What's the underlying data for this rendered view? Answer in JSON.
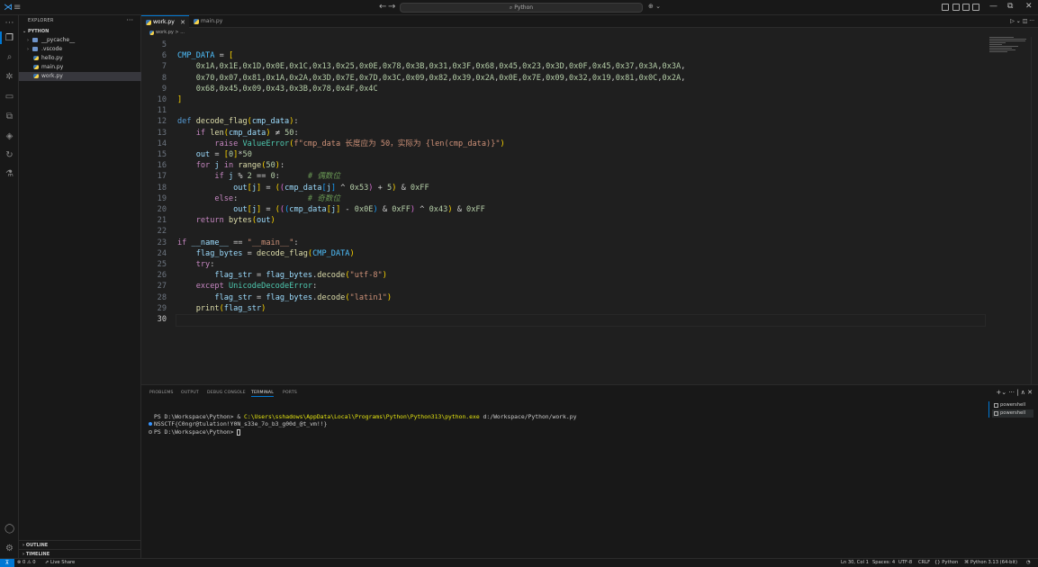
{
  "titlebar": {
    "search_text": "Python",
    "nav_back": "←",
    "nav_forward": "→",
    "copilot_icon": "⊕ ⌄",
    "icons": [
      "vscode-logo-icon",
      "menu-icon",
      "copilot-icon",
      "toggle-layout-icon",
      "minimize-icon",
      "restore-icon",
      "close-icon"
    ],
    "min": "—",
    "restore": "⧉",
    "close": "✕"
  },
  "activity_bar": {
    "items": [
      "explorer-icon",
      "search-icon",
      "source-control-icon",
      "run-debug-icon",
      "remote-explorer-icon",
      "extensions-icon",
      "database-icon",
      "live-share-icon",
      "testing-icon",
      "accounts-icon",
      "settings-icon"
    ]
  },
  "sidebar": {
    "header": "EXPLORER",
    "more": "···",
    "root_folder": "PYTHON",
    "tree": [
      {
        "label": "__pycache__",
        "type": "folder"
      },
      {
        "label": ".vscode",
        "type": "folder"
      },
      {
        "label": "hello.py",
        "type": "file"
      },
      {
        "label": "main.py",
        "type": "file"
      },
      {
        "label": "work.py",
        "type": "file"
      }
    ],
    "outline": "OUTLINE",
    "timeline": "TIMELINE"
  },
  "tabs": [
    {
      "label": "work.py",
      "active": true,
      "close": "✕"
    },
    {
      "label": "main.py",
      "active": false
    }
  ],
  "tab_actions": "▷ ⌄  ◫  ···",
  "breadcrumb": "work.py > ...",
  "editor": {
    "current_line": 30,
    "lines": [
      {
        "n": "5",
        "t": ""
      },
      {
        "n": "6",
        "t": "CMP_DATA = ["
      },
      {
        "n": "7",
        "t": "    0x1A,0x1E,0x1D,0x0E,0x1C,0x13,0x25,0x0E,0x78,0x3B,0x31,0x3F,0x68,0x45,0x23,0x3D,0x0F,0x45,0x37,0x3A,0x3A,"
      },
      {
        "n": "8",
        "t": "    0x70,0x07,0x81,0x1A,0x2A,0x3D,0x7E,0x7D,0x3C,0x09,0x82,0x39,0x2A,0x0E,0x7E,0x09,0x32,0x19,0x81,0x0C,0x2A,"
      },
      {
        "n": "9",
        "t": "    0x68,0x45,0x09,0x43,0x3B,0x78,0x4F,0x4C"
      },
      {
        "n": "10",
        "t": "]"
      },
      {
        "n": "11",
        "t": ""
      },
      {
        "n": "12",
        "t": "def decode_flag(cmp_data):"
      },
      {
        "n": "13",
        "t": "    if len(cmp_data) ≠ 50:"
      },
      {
        "n": "14",
        "t": "        raise ValueError(f\"cmp_data 长度应为 50，实际为 {len(cmp_data)}\")"
      },
      {
        "n": "15",
        "t": "    out = [0]*50"
      },
      {
        "n": "16",
        "t": "    for j in range(50):"
      },
      {
        "n": "17",
        "t": "        if j % 2 == 0:      # 偶数位"
      },
      {
        "n": "18",
        "t": "            out[j] = ((cmp_data[j] ^ 0x53) + 5) & 0xFF"
      },
      {
        "n": "19",
        "t": "        else:               # 奇数位"
      },
      {
        "n": "20",
        "t": "            out[j] = (((cmp_data[j] - 0x0E) & 0xFF) ^ 0x43) & 0xFF"
      },
      {
        "n": "21",
        "t": "    return bytes(out)"
      },
      {
        "n": "22",
        "t": ""
      },
      {
        "n": "23",
        "t": "if __name__ == \"__main__\":"
      },
      {
        "n": "24",
        "t": "    flag_bytes = decode_flag(CMP_DATA)"
      },
      {
        "n": "25",
        "t": "    try:"
      },
      {
        "n": "26",
        "t": "        flag_str = flag_bytes.decode(\"utf-8\")"
      },
      {
        "n": "27",
        "t": "    except UnicodeDecodeError:"
      },
      {
        "n": "28",
        "t": "        flag_str = flag_bytes.decode(\"latin1\")"
      },
      {
        "n": "29",
        "t": "    print(flag_str)"
      },
      {
        "n": "30",
        "t": ""
      }
    ]
  },
  "panel": {
    "tabs": [
      "PROBLEMS",
      "OUTPUT",
      "DEBUG CONSOLE",
      "TERMINAL",
      "PORTS"
    ],
    "active_tab": "TERMINAL",
    "actions": "+⌄ ··· | ∧ ✕",
    "terminal": {
      "prompt1": "PS D:\\Workspace\\Python> & ",
      "exe": "C:\\Users\\sshadows\\AppData\\Local\\Programs\\Python\\Python313\\python.exe",
      "arg": " d:/Workspace/Python/work.py",
      "output": "NSSCTF{C0ngr@tulation!Y0N_s33e_7o_b3_g00d_@t_vm!!}",
      "prompt2": "PS D:\\Workspace\\Python> "
    },
    "terminal_list": [
      "powershell",
      "powershell"
    ]
  },
  "statusbar": {
    "remote": "⊼",
    "problems": "⊗ 0 ⚠ 0",
    "liveshare": "⇗ Live Share",
    "position": "Ln 30, Col 1",
    "spaces": "Spaces: 4",
    "encoding": "UTF-8",
    "eol": "CRLF",
    "language": "{} Python",
    "interpreter": "Python 3.13 (64-bit)",
    "bell": "🔔"
  },
  "colors": {
    "accent": "#0078d4",
    "keyword": "#c586c0",
    "function": "#dcdcaa",
    "string": "#ce9178",
    "number": "#b5cea8",
    "comment": "#6a9955"
  }
}
